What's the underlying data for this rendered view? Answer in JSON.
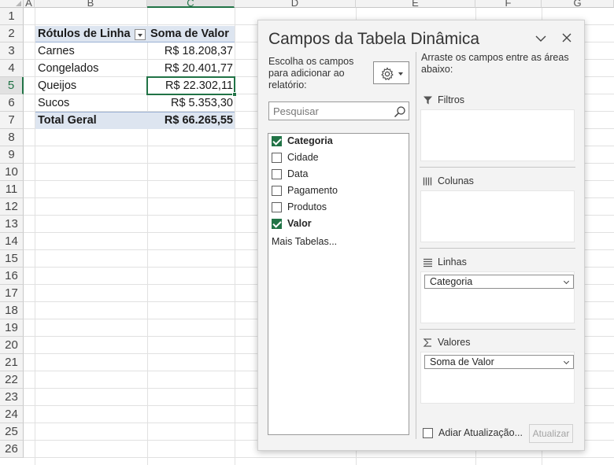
{
  "sheet": {
    "columns": [
      "A",
      "B",
      "C",
      "D",
      "E",
      "F",
      "G"
    ],
    "selected_column": "C",
    "rows": [
      "1",
      "2",
      "3",
      "4",
      "5",
      "6",
      "7",
      "8",
      "9",
      "10",
      "11",
      "12",
      "13",
      "14",
      "15",
      "16",
      "17",
      "18",
      "19",
      "20",
      "21",
      "22",
      "23",
      "24",
      "25",
      "26"
    ],
    "selected_row": "5"
  },
  "pivot_table": {
    "header_row_label": "Rótulos de Linha",
    "header_value": "Soma de Valor",
    "rows": [
      {
        "label": "Carnes",
        "value": "R$ 18.208,37"
      },
      {
        "label": "Congelados",
        "value": "R$ 20.401,77"
      },
      {
        "label": "Queijos",
        "value": "R$ 22.302,11"
      },
      {
        "label": "Sucos",
        "value": "R$ 5.353,30"
      }
    ],
    "total_label": "Total Geral",
    "total_value": "R$ 66.265,55",
    "header_fill": "#dde5f0"
  },
  "pane": {
    "title": "Campos da Tabela Dinâmica",
    "choose_fields_label": "Escolha os campos para adicionar ao relatório:",
    "search_placeholder": "Pesquisar",
    "fields": [
      {
        "label": "Categoria",
        "checked": true
      },
      {
        "label": "Cidade",
        "checked": false
      },
      {
        "label": "Data",
        "checked": false
      },
      {
        "label": "Pagamento",
        "checked": false
      },
      {
        "label": "Produtos",
        "checked": false
      },
      {
        "label": "Valor",
        "checked": true
      }
    ],
    "more_tables": "Mais Tabelas...",
    "drag_label": "Arraste os campos entre as áreas abaixo:",
    "areas": {
      "filters": "Filtros",
      "columns": "Colunas",
      "rows": "Linhas",
      "values": "Valores"
    },
    "rows_item": "Categoria",
    "values_item": "Soma de Valor",
    "defer_update": "Adiar Atualização...",
    "update_button": "Atualizar",
    "accent": "#217346"
  }
}
